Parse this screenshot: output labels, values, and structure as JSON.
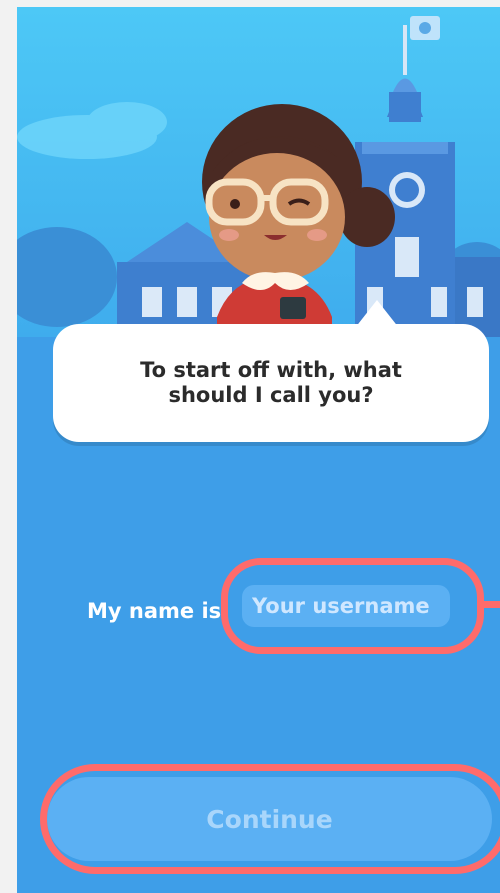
{
  "prompt": {
    "message": "To start off with, what should I call you?"
  },
  "form": {
    "name_label": "My name is",
    "username_placeholder": "Your username",
    "username_value": ""
  },
  "actions": {
    "continue_label": "Continue"
  },
  "colors": {
    "background": "#3e9ee8",
    "sky": "#4cc7f5",
    "bubble": "#ffffff",
    "highlight": "#ff6b6b",
    "button_fill": "#5bb0f3",
    "button_text": "#a9d6fb"
  }
}
